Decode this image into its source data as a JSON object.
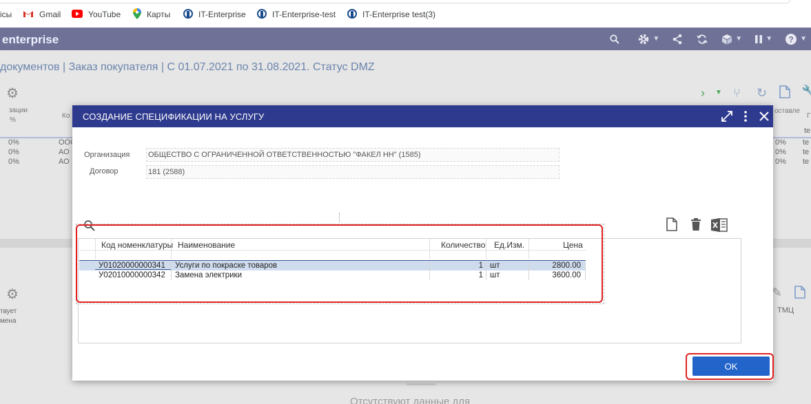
{
  "bookmarks": [
    {
      "label": "ісы",
      "icon": "none"
    },
    {
      "label": "Gmail",
      "icon": "gmail-icon"
    },
    {
      "label": "YouTube",
      "icon": "youtube-icon"
    },
    {
      "label": "Карты",
      "icon": "maps-icon"
    },
    {
      "label": "IT-Enterprise",
      "icon": "it-enterprise-icon"
    },
    {
      "label": "IT-Enterprise-test",
      "icon": "it-enterprise-icon"
    },
    {
      "label": "IT-Enterprise test(3)",
      "icon": "it-enterprise-icon"
    }
  ],
  "app": {
    "logo": "enterprise",
    "page_title": "документов | Заказ покупателя | С 01.07.2021 по 31.08.2021. Статус DMZ"
  },
  "background": {
    "col1_header_a": "зации",
    "col1_header_b": "%",
    "col2_header": "Ко",
    "right_header_a": "оставле",
    "right_header_b": "Г",
    "right_cell": "te",
    "rows": [
      {
        "pct": "0%",
        "code": "ООО",
        "pct_r": "0%",
        "r": "te"
      },
      {
        "pct": "0%",
        "code": "АО",
        "pct_r": "0%",
        "r": "te"
      },
      {
        "pct": "0%",
        "code": "АО",
        "pct_r": "0%",
        "r": "te"
      }
    ],
    "lower_left_a": "твует",
    "lower_left_b": "мена",
    "lower_right": "ТМЦ",
    "bottom_text": "Отсутствуют данные для"
  },
  "dialog": {
    "title": "СОЗДАНИЕ СПЕЦИФИКАЦИИ НА УСЛУГУ",
    "organization_label": "Организация",
    "organization_value": "ОБЩЕСТВО С ОГРАНИЧЕННОЙ ОТВЕТСТВЕННОСТЬЮ \"ФАКЕЛ НН\" (1585)",
    "contract_label": "Договор",
    "contract_value": "181 (2588)",
    "table": {
      "headers": [
        "Код номенклатуры",
        "Наименование",
        "Количество",
        "Ед.Изм.",
        "Цена"
      ],
      "rows": [
        {
          "code": "У01020000000341",
          "name": "Услуги по покраске товаров",
          "qty": "1",
          "unit": "шт",
          "price": "2800.00"
        },
        {
          "code": "У02010000000342",
          "name": "Замена электрики",
          "qty": "1",
          "unit": "шт",
          "price": "3600.00"
        }
      ]
    },
    "ok_label": "OK"
  },
  "colors": {
    "dialog_header": "#2e3a8e",
    "ok_button": "#2264c9",
    "highlight": "#e02020",
    "selected_row": "#cfdcee"
  }
}
